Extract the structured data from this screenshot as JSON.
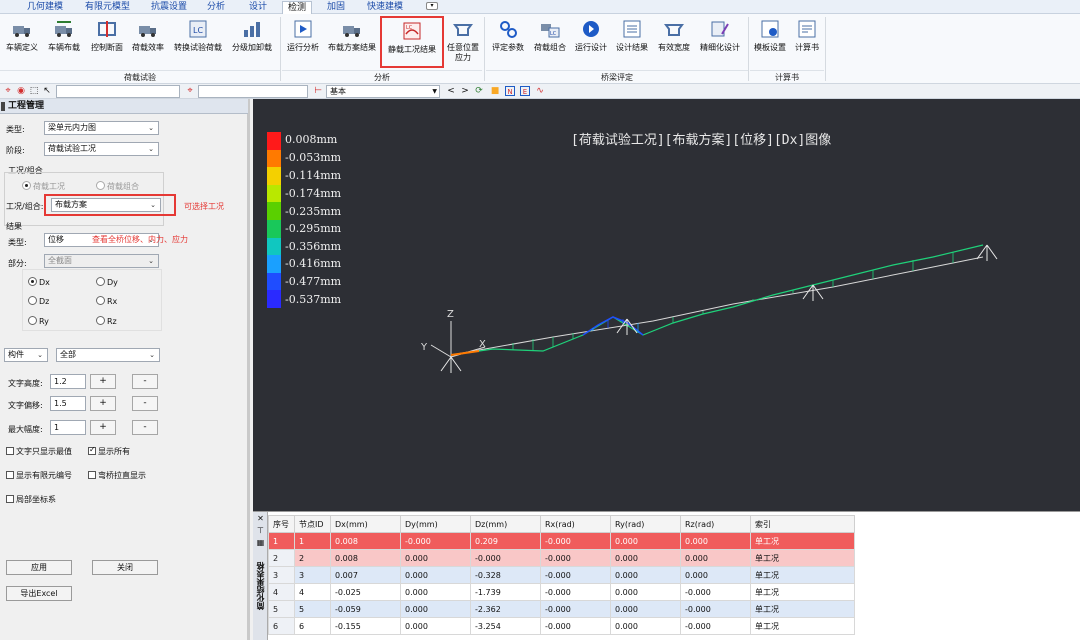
{
  "menu_tabs": [
    "几何建模",
    "有限元模型",
    "抗震设置",
    "分析",
    "设计",
    "检测",
    "加固",
    "快速建模"
  ],
  "active_tab": "检测",
  "ribbon": {
    "buttons": [
      {
        "label": "车辆定义",
        "icon": "truck-icon"
      },
      {
        "label": "车辆布载",
        "icon": "truck-load-icon"
      },
      {
        "label": "控制断面",
        "icon": "section-icon"
      },
      {
        "label": "荷载效率",
        "icon": "load-efficiency-icon"
      },
      {
        "label": "转换试验荷载",
        "icon": "convert-load-icon"
      },
      {
        "label": "分级加卸载",
        "icon": "staged-load-icon"
      },
      {
        "label": "运行分析",
        "icon": "run-analysis-icon"
      },
      {
        "label": "布载方案结果",
        "icon": "load-plan-result-icon"
      },
      {
        "label": "静载工况结果",
        "icon": "static-case-result-icon"
      },
      {
        "label": "任意位置应力",
        "icon": "arbitrary-stress-icon"
      },
      {
        "label": "评定参数",
        "icon": "rating-params-icon"
      },
      {
        "label": "荷载组合",
        "icon": "load-combo-icon"
      },
      {
        "label": "运行设计",
        "icon": "run-design-icon"
      },
      {
        "label": "设计结果",
        "icon": "design-result-icon"
      },
      {
        "label": "有效宽度",
        "icon": "effective-width-icon"
      },
      {
        "label": "精细化设计",
        "icon": "refined-design-icon"
      },
      {
        "label": "模板设置",
        "icon": "template-settings-icon"
      },
      {
        "label": "计算书",
        "icon": "calc-book-icon"
      }
    ],
    "groups": [
      "荷载试验",
      "分析",
      "桥梁评定",
      "计算书"
    ]
  },
  "toolbar": {
    "view_mode": "基本"
  },
  "left_panel": {
    "title": "工程管理",
    "type_label": "类型:",
    "type_value": "梁单元内力图",
    "stage_label": "阶段:",
    "stage_value": "荷载试验工况",
    "case_group_label": "工况/组合",
    "radio_load_case": "荷载工况",
    "radio_load_combo": "荷载组合",
    "case_combo_label": "工况/组合:",
    "case_combo_value": "布载方案",
    "case_note": "可选择工况",
    "result_label": "结果",
    "result_type_label": "类型:",
    "result_type_value": "位移",
    "result_note": "查看全桥位移、内力、应力",
    "part_label": "部分:",
    "part_value": "全截面",
    "components": [
      "Dx",
      "Dy",
      "Dz",
      "Rx",
      "Ry",
      "Rz"
    ],
    "selected_component": "Dx",
    "member_type": "构件",
    "member_scope": "全部",
    "text_height_label": "文字高度:",
    "text_height_value": "1.2",
    "text_offset_label": "文字偏移:",
    "text_offset_value": "1.5",
    "max_amp_label": "最大幅度:",
    "max_amp_value": "1",
    "plus": "+",
    "minus": "-",
    "chk_extreme_only": "文字只显示最值",
    "chk_show_all": "显示所有",
    "chk_show_fe_number": "显示有限元编号",
    "chk_curved_straight": "弯桥拉直显示",
    "chk_local_coord": "局部坐标系",
    "apply_label": "应用",
    "close_label": "关闭",
    "export_label": "导出Excel"
  },
  "viewport": {
    "title": "[荷载试验工况][布载方案][位移][Dx]图像",
    "legend": [
      "0.008mm",
      "-0.053mm",
      "-0.114mm",
      "-0.174mm",
      "-0.235mm",
      "-0.295mm",
      "-0.356mm",
      "-0.416mm",
      "-0.477mm",
      "-0.537mm"
    ],
    "legend_colors": [
      "#ff1a1a",
      "#ff7a00",
      "#f4d000",
      "#b9e800",
      "#5ad000",
      "#19c85a",
      "#10c7c0",
      "#1aa0ff",
      "#1f4dff",
      "#2a2aff"
    ],
    "axis_labels": {
      "z": "Z",
      "y": "Y",
      "x": "X"
    }
  },
  "results": {
    "strip_title": "简化结果表格",
    "columns": [
      "序号",
      "节点ID",
      "Dx(mm)",
      "Dy(mm)",
      "Dz(mm)",
      "Rx(rad)",
      "Ry(rad)",
      "Rz(rad)",
      "索引"
    ],
    "rows": [
      [
        "1",
        "1",
        "0.008",
        "-0.000",
        "0.209",
        "-0.000",
        "0.000",
        "0.000",
        "单工况"
      ],
      [
        "2",
        "2",
        "0.008",
        "0.000",
        "-0.000",
        "-0.000",
        "0.000",
        "0.000",
        "单工况"
      ],
      [
        "3",
        "3",
        "0.007",
        "0.000",
        "-0.328",
        "-0.000",
        "0.000",
        "0.000",
        "单工况"
      ],
      [
        "4",
        "4",
        "-0.025",
        "0.000",
        "-1.739",
        "-0.000",
        "0.000",
        "-0.000",
        "单工况"
      ],
      [
        "5",
        "5",
        "-0.059",
        "0.000",
        "-2.362",
        "-0.000",
        "0.000",
        "-0.000",
        "单工况"
      ],
      [
        "6",
        "6",
        "-0.155",
        "0.000",
        "-3.254",
        "-0.000",
        "0.000",
        "-0.000",
        "单工况"
      ]
    ]
  }
}
